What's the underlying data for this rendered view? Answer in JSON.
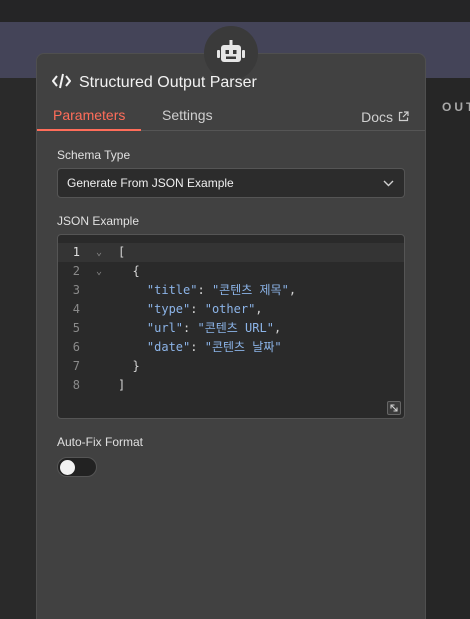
{
  "header": {
    "output_label": "OUT"
  },
  "node": {
    "icon": "robot-icon",
    "title_icon": "code-icon",
    "title": "Structured Output Parser"
  },
  "tabs": [
    {
      "label": "Parameters",
      "active": true
    },
    {
      "label": "Settings",
      "active": false
    }
  ],
  "docs": {
    "label": "Docs",
    "icon": "external-link-icon"
  },
  "schema_type": {
    "label": "Schema Type",
    "value": "Generate From JSON Example",
    "icon": "chevron-down-icon"
  },
  "json_example": {
    "label": "JSON Example",
    "lines": [
      {
        "number": "1",
        "code": "["
      },
      {
        "number": "2",
        "code": "  {"
      },
      {
        "number": "3",
        "code": "    \"title\": \"콘텐츠 제목\","
      },
      {
        "number": "4",
        "code": "    \"type\": \"other\","
      },
      {
        "number": "5",
        "code": "    \"url\": \"콘텐츠 URL\","
      },
      {
        "number": "6",
        "code": "    \"date\": \"콘텐츠 날짜\""
      },
      {
        "number": "7",
        "code": "  }"
      },
      {
        "number": "8",
        "code": "]"
      }
    ],
    "active_line": 1,
    "fold_marker": "⌄"
  },
  "auto_fix": {
    "label": "Auto-Fix Format",
    "enabled": false
  },
  "colors": {
    "accent": "#ff6d5a",
    "json_key": "#8cb4e8",
    "panel": "#414141"
  }
}
